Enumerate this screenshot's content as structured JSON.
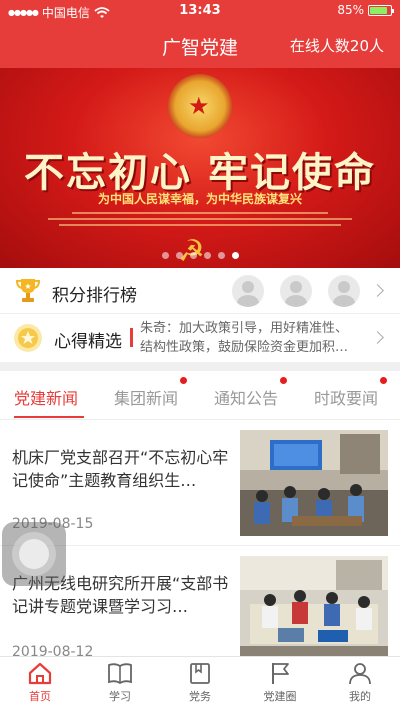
{
  "status_bar": {
    "carrier": "中国电信",
    "time": "13:43",
    "battery": "85%",
    "battery_level": 0.85,
    "wifi_icon": "wifi-icon"
  },
  "header": {
    "title": "广智党建",
    "online": "在线人数20人"
  },
  "banner": {
    "slogan": "不忘初心 牢记使命",
    "subtitle": "为中国人民谋幸福，为中华民族谋复兴",
    "slide_count": 6,
    "active_slide": 6
  },
  "ranking": {
    "label": "积分排行榜",
    "icon": "trophy-icon"
  },
  "notes": {
    "label": "心得精选",
    "text": "朱奇：加大政策引导，用好精准性、\n结构性政策，鼓励保险资金更加积…",
    "icon": "medal-icon"
  },
  "tabs": [
    {
      "label": "党建新闻",
      "active": true,
      "dot": false
    },
    {
      "label": "集团新闻",
      "active": false,
      "dot": true
    },
    {
      "label": "通知公告",
      "active": false,
      "dot": true
    },
    {
      "label": "时政要闻",
      "active": false,
      "dot": true
    }
  ],
  "news": [
    {
      "title": "机床厂党支部召开“不忘初心牢记使命”主题教育组织生…",
      "date": "2019-08-15"
    },
    {
      "title": "广州无线电研究所开展“支部书记讲专题党课暨学习习…",
      "date": "2019-08-12"
    }
  ],
  "tabbar": [
    {
      "label": "首页",
      "icon": "home-icon",
      "active": true
    },
    {
      "label": "学习",
      "icon": "book-icon",
      "active": false
    },
    {
      "label": "党务",
      "icon": "party-affairs-icon",
      "active": false
    },
    {
      "label": "党建圈",
      "icon": "flag-icon",
      "active": false
    },
    {
      "label": "我的",
      "icon": "profile-icon",
      "active": false
    }
  ],
  "colors": {
    "brand_red": "#e73d3a",
    "battery_green": "#8df061"
  }
}
